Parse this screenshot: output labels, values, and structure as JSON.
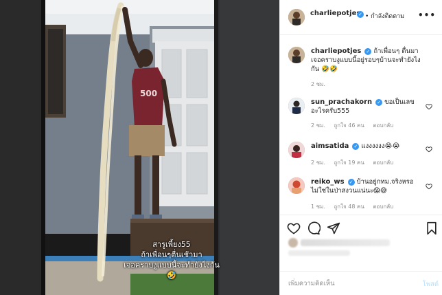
{
  "post": {
    "caption_lines": [
      "สารูเพี้ยง55",
      "ถ้าเพื่อนๆตื่นเช้ามา",
      "เจอคราบงูแบบนี้จะทำยังไงกัน",
      "🤣"
    ]
  },
  "header": {
    "username": "charliepotjes",
    "follow_label": "• กำลังติดตาม",
    "more_icon": "more-icon"
  },
  "comments": [
    {
      "username": "charliepotjes",
      "text": "ถ้าเพื่อนๆ ตื่นมาเจอคราบงูแบบนี้อยู่รอบๆบ้านจะทำยังไงกัน 🤣🤣",
      "time": "2 ชม.",
      "likes": "",
      "reply": ""
    },
    {
      "username": "sun_prachakorn",
      "text": "ขอเป็นเลขอะไรครับ555",
      "time": "2 ชม.",
      "likes": "ถูกใจ 46 คน",
      "reply": "ตอบกลับ"
    },
    {
      "username": "aimsatida",
      "text": "แงงงงงง😭😭",
      "time": "2 ชม.",
      "likes": "ถูกใจ 19 คน",
      "reply": "ตอบกลับ"
    },
    {
      "username": "reiko_ws",
      "text": "บ้านอยู่กทม.จริงหรอ ไม่ใช่ในป่าสงวนแน่นะ😱😅",
      "time": "1 ชม.",
      "likes": "ถูกใจ 48 คน",
      "reply": "ตอบกลับ"
    }
  ],
  "add_comment": {
    "placeholder": "เพิ่มความคิดเห็น",
    "post_label": "โพสต์"
  },
  "colors": {
    "verified": "#3897f0",
    "post_button_disabled": "#b2dffc",
    "meta_gray": "#8e8e8e"
  }
}
